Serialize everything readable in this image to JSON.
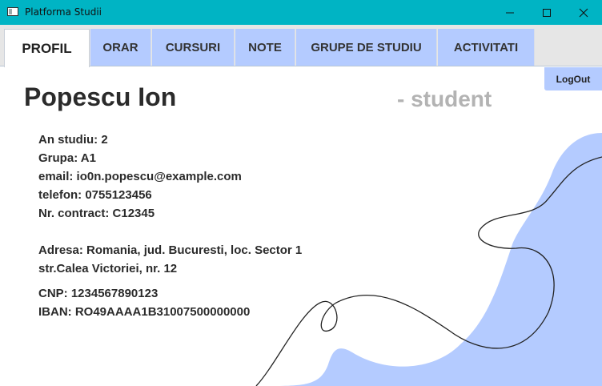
{
  "window": {
    "title": "Platforma Studii"
  },
  "tabs": [
    {
      "label": "PROFIL",
      "active": true
    },
    {
      "label": "ORAR"
    },
    {
      "label": "CURSURI"
    },
    {
      "label": "NOTE"
    },
    {
      "label": "GRUPE DE STUDIU"
    },
    {
      "label": "ACTIVITATI"
    }
  ],
  "actions": {
    "logout_label": "LogOut"
  },
  "profile": {
    "name": "Popescu Ion",
    "role": "- student",
    "an_studiu": {
      "label": "An studiu",
      "value": "2"
    },
    "grupa": {
      "label": "Grupa",
      "value": "A1"
    },
    "email": {
      "label": "email",
      "value": "io0n.popescu@example.com"
    },
    "telefon": {
      "label": "telefon",
      "value": "0755123456"
    },
    "contract": {
      "label": "Nr. contract",
      "value": "C12345"
    },
    "adresa": {
      "label": "Adresa",
      "line1": "Romania, jud. Bucuresti, loc. Sector 1",
      "line2": "str.Calea Victoriei, nr. 12"
    },
    "cnp": {
      "label": "CNP",
      "value": "1234567890123"
    },
    "iban": {
      "label": "IBAN",
      "value": "RO49AAAA1B31007500000000"
    }
  },
  "colors": {
    "titlebar": "#00b4c4",
    "tab": "#b4cbff",
    "blob": "#b4cbff",
    "role_text": "#b3b3b3"
  }
}
